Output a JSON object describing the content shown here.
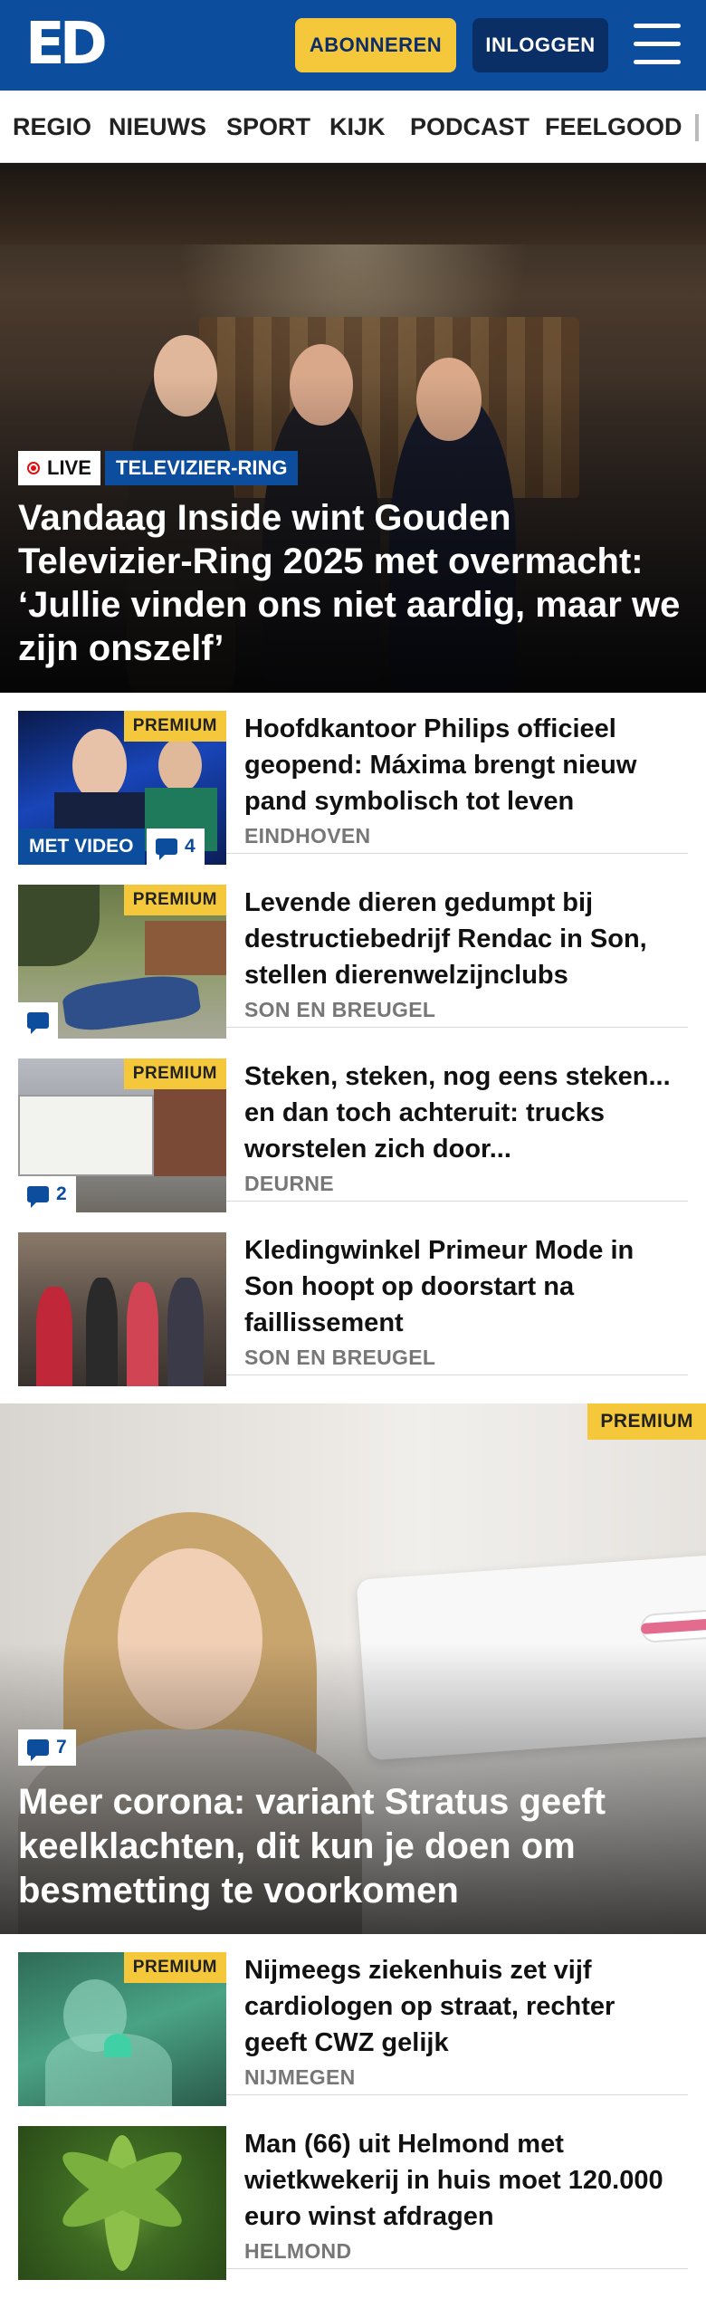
{
  "header": {
    "logo": "ED",
    "subscribe_label": "ABONNEREN",
    "login_label": "INLOGGEN",
    "colors": {
      "brand": "#0c4d9e",
      "accent": "#f5c73b"
    }
  },
  "nav": {
    "items": [
      "REGIO",
      "NIEUWS",
      "SPORT",
      "KIJK",
      "PODCAST",
      "FEELGOOD"
    ]
  },
  "hero": {
    "live_label": "LIVE",
    "tag": "TELEVIZIER-RING",
    "title": "Vandaag Inside wint Gouden Televizier-Ring 2025 met overmacht: ‘Jullie vinden ons niet aardig, maar we zijn onszelf’"
  },
  "articles": [
    {
      "title": "Hoofdkantoor Philips officieel geopend: Máxima brengt nieuw pand symbolisch tot leven",
      "location": "EINDHOVEN",
      "premium_label": "PREMIUM",
      "video_label": "MET VIDEO",
      "comments": "4"
    },
    {
      "title": "Levende dieren gedumpt bij destructiebedrijf Rendac in Son, stellen dierenwelzijnclubs",
      "location": "SON EN BREUGEL",
      "premium_label": "PREMIUM"
    },
    {
      "title": "Steken, steken, nog eens steken... en dan toch achteruit: trucks worstelen zich door...",
      "location": "DEURNE",
      "premium_label": "PREMIUM",
      "comments": "2"
    },
    {
      "title": "Kledingwinkel Primeur Mode in Son hoopt op doorstart na faillissement",
      "location": "SON EN BREUGEL"
    }
  ],
  "big_story": {
    "premium_label": "PREMIUM",
    "comments": "7",
    "title": "Meer corona: variant Stratus geeft keelklachten, dit kun je doen om besmetting te voorkomen"
  },
  "articles_bottom": [
    {
      "title": "Nijmeegs ziekenhuis zet vijf cardiologen op straat, rechter geeft CWZ gelijk",
      "location": "NIJMEGEN",
      "premium_label": "PREMIUM"
    },
    {
      "title": "Man (66) uit Helmond met wietkwekerij in huis moet 120.000 euro winst afdragen",
      "location": "HELMOND"
    }
  ]
}
